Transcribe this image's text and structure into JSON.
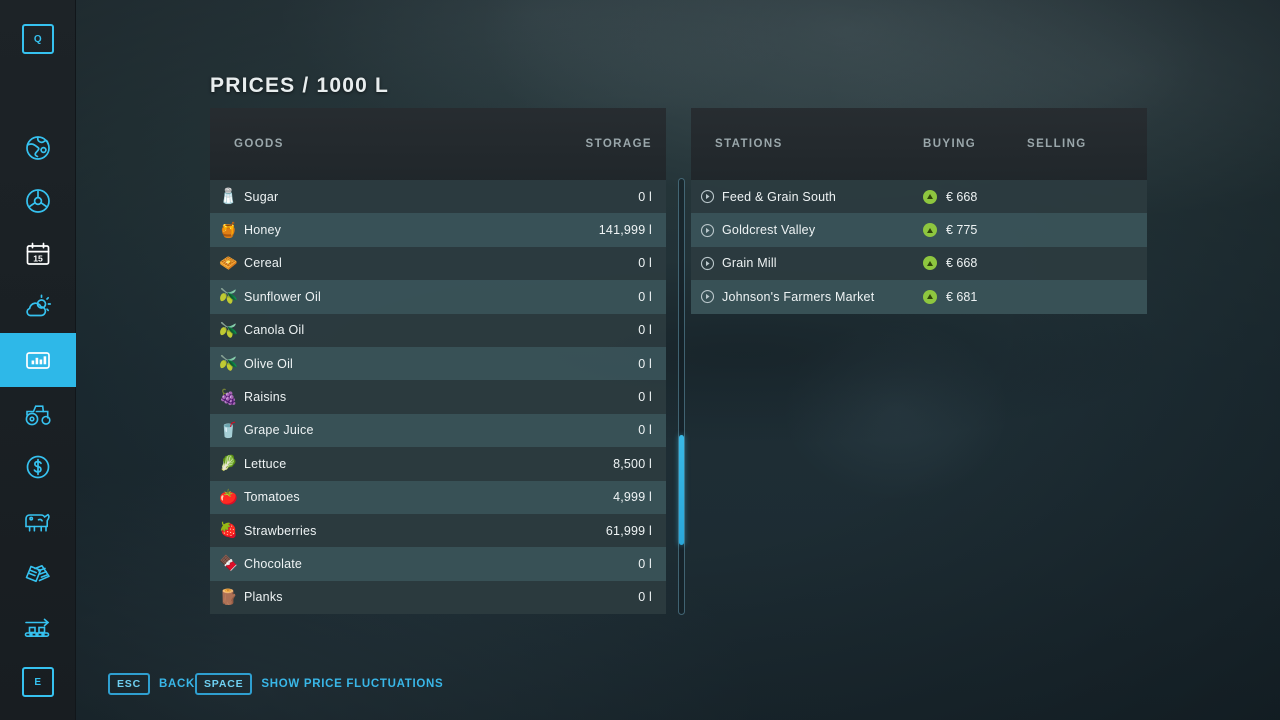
{
  "page": {
    "title": "PRICES / 1000 L"
  },
  "sidebar": {
    "top_key": "Q",
    "bottom_key": "E",
    "items": [
      {
        "name": "map-icon",
        "label": "Map"
      },
      {
        "name": "vehicles-icon",
        "label": "Vehicle Overview"
      },
      {
        "name": "calendar-icon",
        "label": "Calendar",
        "day": "15"
      },
      {
        "name": "weather-icon",
        "label": "Weather"
      },
      {
        "name": "prices-icon",
        "label": "Prices",
        "active": true
      },
      {
        "name": "tractor-icon",
        "label": "Vehicles"
      },
      {
        "name": "finances-icon",
        "label": "Finances"
      },
      {
        "name": "animals-icon",
        "label": "Animals"
      },
      {
        "name": "contracts-icon",
        "label": "Contracts"
      },
      {
        "name": "production-icon",
        "label": "Production"
      }
    ]
  },
  "goods_panel": {
    "columns": {
      "name": "GOODS",
      "storage": "STORAGE"
    },
    "rows": [
      {
        "icon": "sugar-icon",
        "glyph": "🧂",
        "name": "Sugar",
        "storage": "0 l"
      },
      {
        "icon": "honey-icon",
        "glyph": "🍯",
        "name": "Honey",
        "storage": "141,999 l"
      },
      {
        "icon": "cereal-icon",
        "glyph": "🧇",
        "name": "Cereal",
        "storage": "0 l"
      },
      {
        "icon": "sunflower-oil-icon",
        "glyph": "🫒",
        "name": "Sunflower Oil",
        "storage": "0 l"
      },
      {
        "icon": "canola-oil-icon",
        "glyph": "🫒",
        "name": "Canola Oil",
        "storage": "0 l"
      },
      {
        "icon": "olive-oil-icon",
        "glyph": "🫒",
        "name": "Olive Oil",
        "storage": "0 l"
      },
      {
        "icon": "raisins-icon",
        "glyph": "🍇",
        "name": "Raisins",
        "storage": "0 l"
      },
      {
        "icon": "grape-juice-icon",
        "glyph": "🥤",
        "name": "Grape Juice",
        "storage": "0 l"
      },
      {
        "icon": "lettuce-icon",
        "glyph": "🥬",
        "name": "Lettuce",
        "storage": "8,500 l"
      },
      {
        "icon": "tomatoes-icon",
        "glyph": "🍅",
        "name": "Tomatoes",
        "storage": "4,999 l"
      },
      {
        "icon": "strawberries-icon",
        "glyph": "🍓",
        "name": "Strawberries",
        "storage": "61,999 l"
      },
      {
        "icon": "chocolate-icon",
        "glyph": "🍫",
        "name": "Chocolate",
        "storage": "0 l"
      },
      {
        "icon": "planks-icon",
        "glyph": "🪵",
        "name": "Planks",
        "storage": "0 l"
      }
    ]
  },
  "stations_panel": {
    "columns": {
      "name": "STATIONS",
      "buying": "BUYING",
      "selling": "SELLING"
    },
    "rows": [
      {
        "name": "Feed & Grain South",
        "trend": "up",
        "buying": "€ 668",
        "selling": ""
      },
      {
        "name": "Goldcrest Valley",
        "trend": "up",
        "buying": "€ 775",
        "selling": ""
      },
      {
        "name": "Grain Mill",
        "trend": "up",
        "buying": "€ 668",
        "selling": ""
      },
      {
        "name": "Johnson's Farmers Market",
        "trend": "up",
        "buying": "€ 681",
        "selling": ""
      }
    ]
  },
  "footer": {
    "hints": [
      {
        "key": "ESC",
        "label": "BACK"
      },
      {
        "key": "SPACE",
        "label": "SHOW PRICE FLUCTUATIONS"
      }
    ]
  },
  "colors": {
    "accent": "#2eb8e8",
    "accent_text": "#39b7e8",
    "trend_up": "#8ec63f",
    "row_odd": "#2c3b40",
    "row_even": "#3a5459",
    "header": "#272c30",
    "background": "#1e2e35"
  }
}
